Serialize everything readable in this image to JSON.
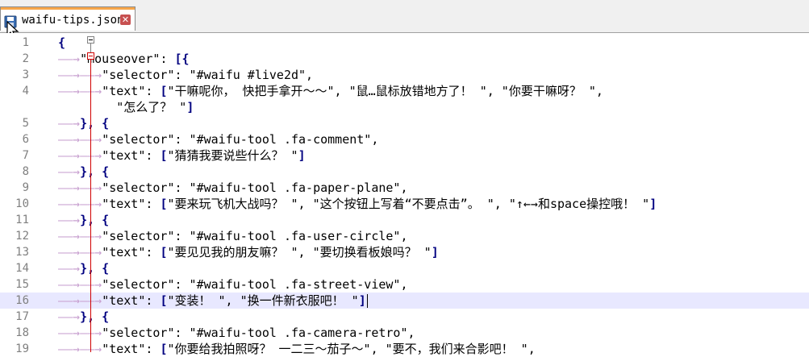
{
  "tab": {
    "title": "waifu-tips.json",
    "close_glyph": "✕"
  },
  "lines": [
    {
      "n": "1",
      "segs": [
        {
          "c": "br",
          "t": "{"
        }
      ]
    },
    {
      "n": "2",
      "segs": [
        {
          "c": "arrow",
          "t": "——→"
        },
        {
          "c": "key",
          "t": "\"mouseover\""
        },
        {
          "c": "str",
          "t": ": "
        },
        {
          "c": "br",
          "t": "[{"
        }
      ]
    },
    {
      "n": "3",
      "segs": [
        {
          "c": "arrow",
          "t": "——→——→"
        },
        {
          "c": "key",
          "t": "\"selector\""
        },
        {
          "c": "str",
          "t": ": \"#waifu #live2d\","
        }
      ]
    },
    {
      "n": "4",
      "segs": [
        {
          "c": "arrow",
          "t": "——→——→"
        },
        {
          "c": "key",
          "t": "\"text\""
        },
        {
          "c": "str",
          "t": ": "
        },
        {
          "c": "br",
          "t": "["
        },
        {
          "c": "str",
          "t": "\"干嘛呢你， 快把手拿开～～\", \"鼠…鼠标放错地方了！ \", \"你要干嘛呀？ \","
        }
      ]
    },
    {
      "n": "",
      "segs": [
        {
          "c": "str",
          "t": "        \"怎么了？ \""
        },
        {
          "c": "br",
          "t": "]"
        }
      ]
    },
    {
      "n": "5",
      "segs": [
        {
          "c": "arrow",
          "t": "——→"
        },
        {
          "c": "br",
          "t": "}, {"
        }
      ]
    },
    {
      "n": "6",
      "segs": [
        {
          "c": "arrow",
          "t": "——→——→"
        },
        {
          "c": "key",
          "t": "\"selector\""
        },
        {
          "c": "str",
          "t": ": \"#waifu-tool .fa-comment\","
        }
      ]
    },
    {
      "n": "7",
      "segs": [
        {
          "c": "arrow",
          "t": "——→——→"
        },
        {
          "c": "key",
          "t": "\"text\""
        },
        {
          "c": "str",
          "t": ": "
        },
        {
          "c": "br",
          "t": "["
        },
        {
          "c": "str",
          "t": "\"猜猜我要说些什么？ \""
        },
        {
          "c": "br",
          "t": "]"
        }
      ]
    },
    {
      "n": "8",
      "segs": [
        {
          "c": "arrow",
          "t": "——→"
        },
        {
          "c": "br",
          "t": "}, {"
        }
      ]
    },
    {
      "n": "9",
      "segs": [
        {
          "c": "arrow",
          "t": "——→——→"
        },
        {
          "c": "key",
          "t": "\"selector\""
        },
        {
          "c": "str",
          "t": ": \"#waifu-tool .fa-paper-plane\","
        }
      ]
    },
    {
      "n": "10",
      "segs": [
        {
          "c": "arrow",
          "t": "——→——→"
        },
        {
          "c": "key",
          "t": "\"text\""
        },
        {
          "c": "str",
          "t": ": "
        },
        {
          "c": "br",
          "t": "["
        },
        {
          "c": "str",
          "t": "\"要来玩飞机大战吗？ \", \"这个按钮上写着“不要点击”。 \", \"↑←→和space操控哦！ \""
        },
        {
          "c": "br",
          "t": "]"
        }
      ]
    },
    {
      "n": "11",
      "segs": [
        {
          "c": "arrow",
          "t": "——→"
        },
        {
          "c": "br",
          "t": "}, {"
        }
      ]
    },
    {
      "n": "12",
      "segs": [
        {
          "c": "arrow",
          "t": "——→——→"
        },
        {
          "c": "key",
          "t": "\"selector\""
        },
        {
          "c": "str",
          "t": ": \"#waifu-tool .fa-user-circle\","
        }
      ]
    },
    {
      "n": "13",
      "segs": [
        {
          "c": "arrow",
          "t": "——→——→"
        },
        {
          "c": "key",
          "t": "\"text\""
        },
        {
          "c": "str",
          "t": ": "
        },
        {
          "c": "br",
          "t": "["
        },
        {
          "c": "str",
          "t": "\"要见见我的朋友嘛？ \", \"要切换看板娘吗？ \""
        },
        {
          "c": "br",
          "t": "]"
        }
      ]
    },
    {
      "n": "14",
      "segs": [
        {
          "c": "arrow",
          "t": "——→"
        },
        {
          "c": "br",
          "t": "}, {"
        }
      ]
    },
    {
      "n": "15",
      "segs": [
        {
          "c": "arrow",
          "t": "——→——→"
        },
        {
          "c": "key",
          "t": "\"selector\""
        },
        {
          "c": "str",
          "t": ": \"#waifu-tool .fa-street-view\","
        }
      ]
    },
    {
      "n": "16",
      "current": true,
      "segs": [
        {
          "c": "arrow",
          "t": "——→——→"
        },
        {
          "c": "key",
          "t": "\"text\""
        },
        {
          "c": "str",
          "t": ": "
        },
        {
          "c": "br",
          "t": "["
        },
        {
          "c": "str",
          "t": "\"变装！ \", \"换一件新衣服吧！ \""
        },
        {
          "c": "br",
          "t": "]"
        }
      ]
    },
    {
      "n": "17",
      "segs": [
        {
          "c": "arrow",
          "t": "——→"
        },
        {
          "c": "br",
          "t": "}, {"
        }
      ]
    },
    {
      "n": "18",
      "segs": [
        {
          "c": "arrow",
          "t": "——→——→"
        },
        {
          "c": "key",
          "t": "\"selector\""
        },
        {
          "c": "str",
          "t": ": \"#waifu-tool .fa-camera-retro\","
        }
      ]
    },
    {
      "n": "19",
      "segs": [
        {
          "c": "arrow",
          "t": "——→——→"
        },
        {
          "c": "key",
          "t": "\"text\""
        },
        {
          "c": "str",
          "t": ": "
        },
        {
          "c": "br",
          "t": "["
        },
        {
          "c": "str",
          "t": "\"你要给我拍照呀？ 一二三～茄子～\", \"要不，我们来合影吧！ \","
        }
      ]
    }
  ]
}
